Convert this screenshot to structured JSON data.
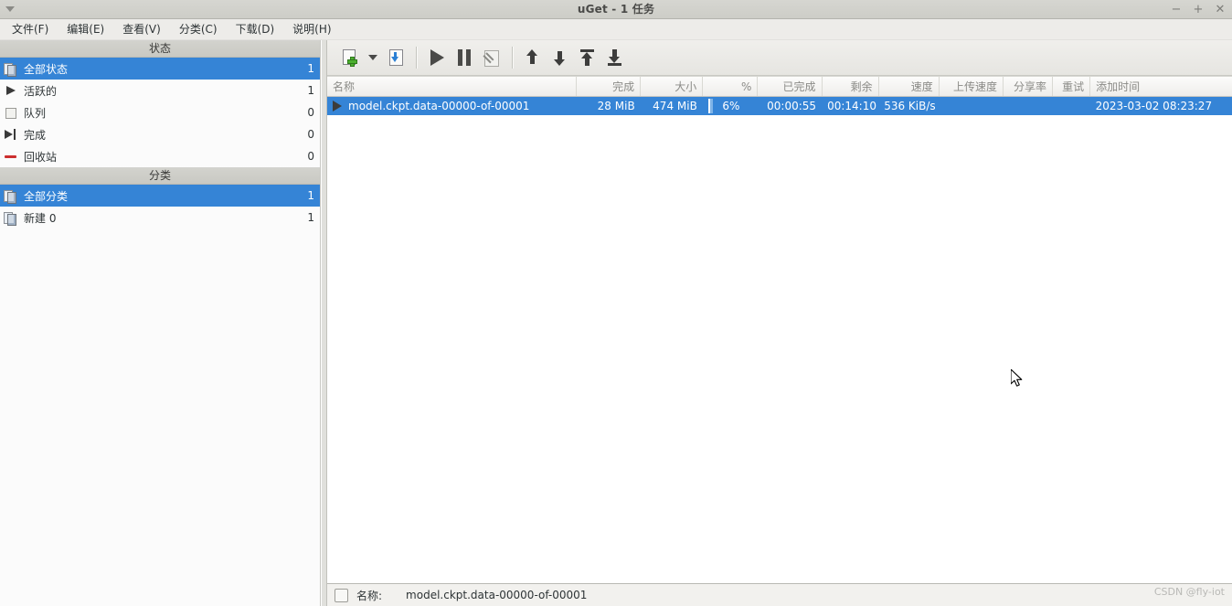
{
  "window": {
    "title": "uGet - 1 任务",
    "menu_arrow_icon": "caret-down-icon",
    "controls": [
      {
        "name": "minimize",
        "glyph": "−"
      },
      {
        "name": "maximize",
        "glyph": "+"
      },
      {
        "name": "close",
        "glyph": "✕"
      }
    ]
  },
  "menubar": {
    "items": [
      {
        "label": "文件(F)",
        "name": "file"
      },
      {
        "label": "编辑(E)",
        "name": "edit"
      },
      {
        "label": "查看(V)",
        "name": "view"
      },
      {
        "label": "分类(C)",
        "name": "category"
      },
      {
        "label": "下载(D)",
        "name": "download"
      },
      {
        "label": "说明(H)",
        "name": "help"
      }
    ]
  },
  "sidebar": {
    "status_section": {
      "title": "状态",
      "items": [
        {
          "label": "全部状态",
          "count": "1",
          "icon": "pages-icon",
          "selected": true
        },
        {
          "label": "活跃的",
          "count": "1",
          "icon": "play-icon",
          "selected": false
        },
        {
          "label": "队列",
          "count": "0",
          "icon": "square-icon",
          "selected": false
        },
        {
          "label": "完成",
          "count": "0",
          "icon": "arrow-to-bar-icon",
          "selected": false
        },
        {
          "label": "回收站",
          "count": "0",
          "icon": "minus-icon",
          "selected": false
        }
      ]
    },
    "category_section": {
      "title": "分类",
      "items": [
        {
          "label": "全部分类",
          "count": "1",
          "icon": "pages-icon",
          "selected": true
        },
        {
          "label": "新建 0",
          "count": "1",
          "icon": "pages-icon",
          "selected": false
        }
      ]
    }
  },
  "toolbar": {
    "buttons": [
      {
        "name": "new-download",
        "icon": "new-task-icon"
      },
      {
        "name": "new-download-menu",
        "icon": "caret-down-icon"
      },
      {
        "name": "import-download",
        "icon": "import-icon"
      },
      {
        "name": "start-download",
        "icon": "play-icon"
      },
      {
        "name": "pause-download",
        "icon": "pause-icon"
      },
      {
        "name": "download-settings",
        "icon": "wrench-icon"
      },
      {
        "name": "move-up",
        "icon": "arrow-up-icon"
      },
      {
        "name": "move-down",
        "icon": "arrow-down-icon"
      },
      {
        "name": "move-to-top",
        "icon": "arrow-to-top-icon"
      },
      {
        "name": "move-to-bottom",
        "icon": "arrow-to-bottom-icon"
      }
    ]
  },
  "table": {
    "columns": [
      {
        "key": "name",
        "label": "名称",
        "align": "left"
      },
      {
        "key": "completed",
        "label": "完成",
        "align": "right"
      },
      {
        "key": "size",
        "label": "大小",
        "align": "right"
      },
      {
        "key": "percent",
        "label": "%",
        "align": "right"
      },
      {
        "key": "elapsed",
        "label": "已完成",
        "align": "right"
      },
      {
        "key": "remaining",
        "label": "剩余",
        "align": "right"
      },
      {
        "key": "speed",
        "label": "速度",
        "align": "right"
      },
      {
        "key": "upload_speed",
        "label": "上传速度",
        "align": "right"
      },
      {
        "key": "share_ratio",
        "label": "分享率",
        "align": "right"
      },
      {
        "key": "retry",
        "label": "重试",
        "align": "right"
      },
      {
        "key": "added_time",
        "label": "添加时间",
        "align": "left"
      }
    ],
    "rows": [
      {
        "selected": true,
        "state_icon": "play-icon",
        "name": "model.ckpt.data-00000-of-00001",
        "completed": "28 MiB",
        "size": "474 MiB",
        "percent": "6%",
        "percent_value": 6,
        "elapsed": "00:00:55",
        "remaining": "00:14:10",
        "speed": "536 KiB/s",
        "upload_speed": "",
        "share_ratio": "",
        "retry": "",
        "added_time": "2023-03-02 08:23:27"
      }
    ]
  },
  "statusbar": {
    "checkbox_checked": false,
    "label": "名称:",
    "value": "model.ckpt.data-00000-of-00001",
    "watermark": "CSDN @fly-iot"
  },
  "colors": {
    "selection": "#3584d6",
    "progress_fill": "#7fb4e8",
    "titlebar": "#d2d2cc",
    "accent_green": "#4caf2f",
    "accent_blue": "#2a7fd4",
    "recycle_red": "#cc2f2f"
  }
}
